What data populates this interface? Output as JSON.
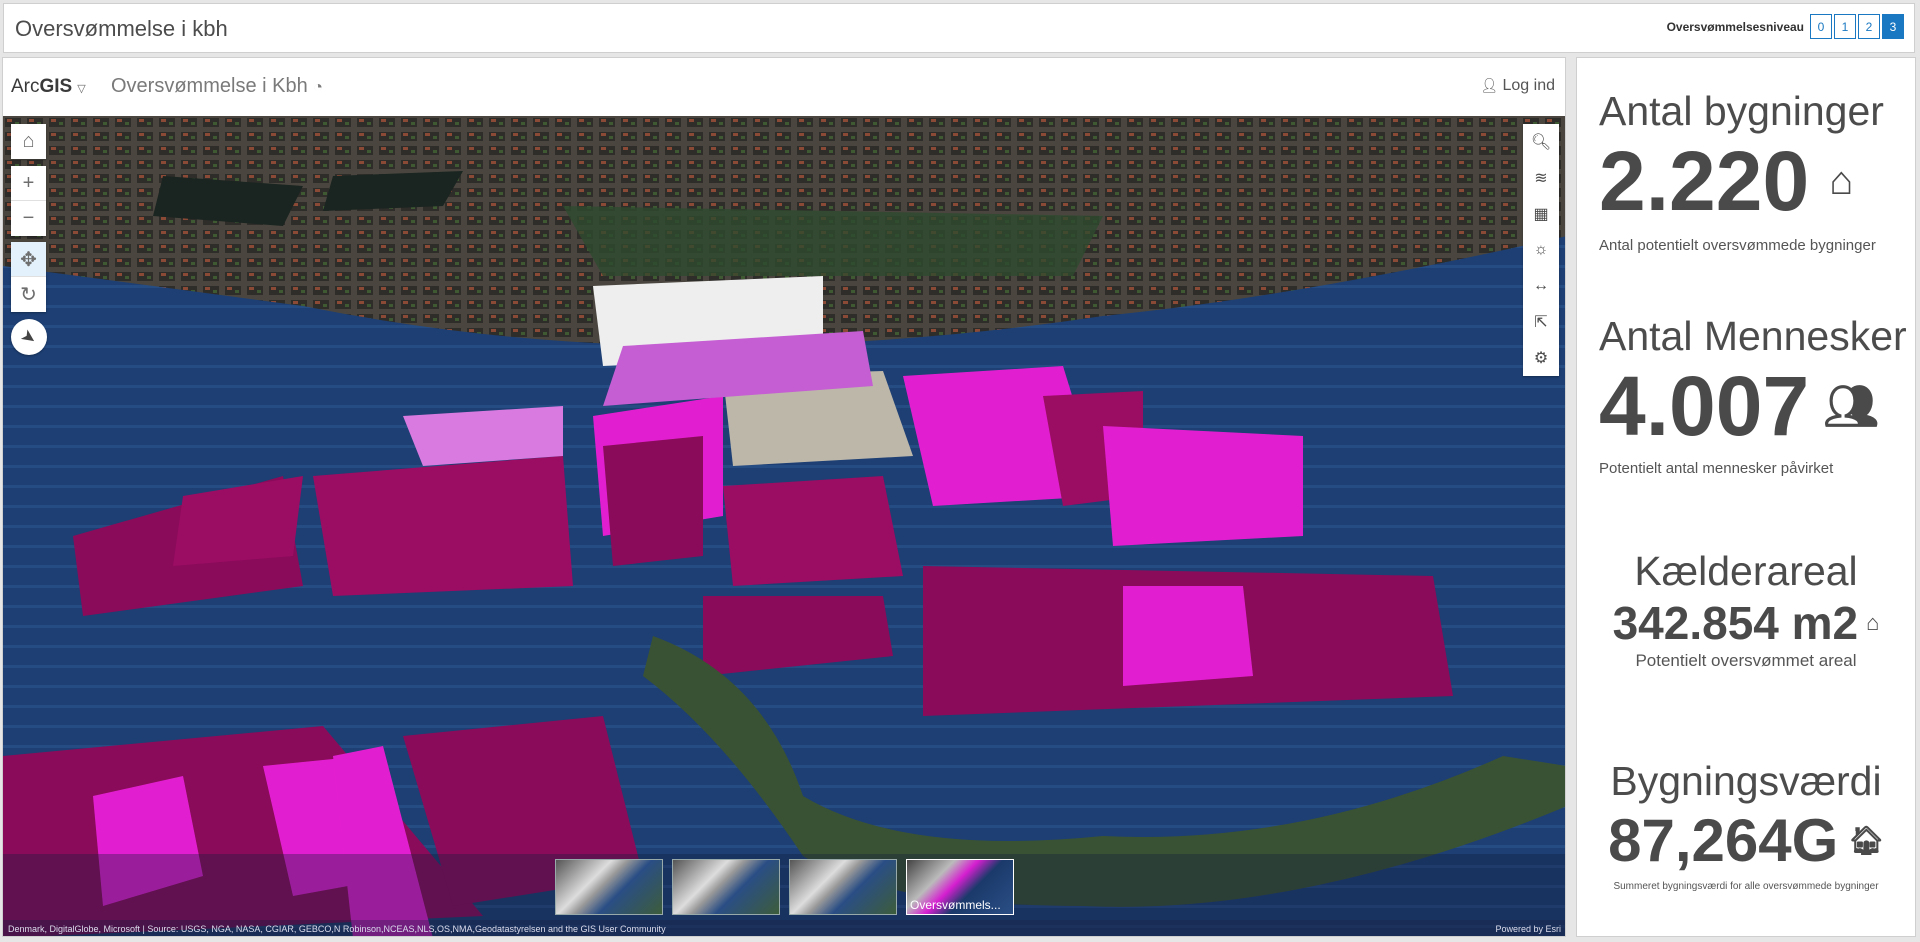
{
  "header": {
    "title": "Oversvømmelse i kbh",
    "level_label": "Oversvømmelsesniveau",
    "levels": [
      "0",
      "1",
      "2",
      "3"
    ],
    "active_level": "3"
  },
  "appbar": {
    "brand_light": "Arc",
    "brand_bold": "GIS",
    "title": "Oversvømmelse i Kbh",
    "login": "Log ind"
  },
  "map": {
    "slides": [
      "",
      "",
      "",
      "Oversvømmels..."
    ],
    "attribution": "Denmark, DigitalGlobe, Microsoft | Source: USGS, NGA, NASA, CGIAR, GEBCO,N Robinson,NCEAS,NLS,OS,NMA,Geodatastyrelsen and the GIS User Community",
    "powered_by": "Powered by Esri"
  },
  "indicators": [
    {
      "title": "Antal bygninger",
      "value": "2.220",
      "subtitle": "Antal potentielt oversvømmede bygninger",
      "icon": "flooded-house-icon"
    },
    {
      "title": "Antal Mennesker",
      "value": "4.007",
      "subtitle": "Potentielt antal mennesker påvirket",
      "icon": "people-icon"
    },
    {
      "title": "Kælderareal",
      "value": "342.854 m2",
      "subtitle": "Potentielt oversvømmet areal",
      "icon": "flooded-house-icon"
    },
    {
      "title": "Bygningsværdi",
      "value": "87,264G",
      "subtitle": "Summeret bygningsværdi for alle oversvømmede bygninger",
      "icon": "house-dollar-icon"
    }
  ],
  "colors": {
    "accent": "#1a78c2",
    "flood": "#1b3a6b",
    "building_high": "#e21fd0",
    "building_low": "#8a0b5a"
  }
}
